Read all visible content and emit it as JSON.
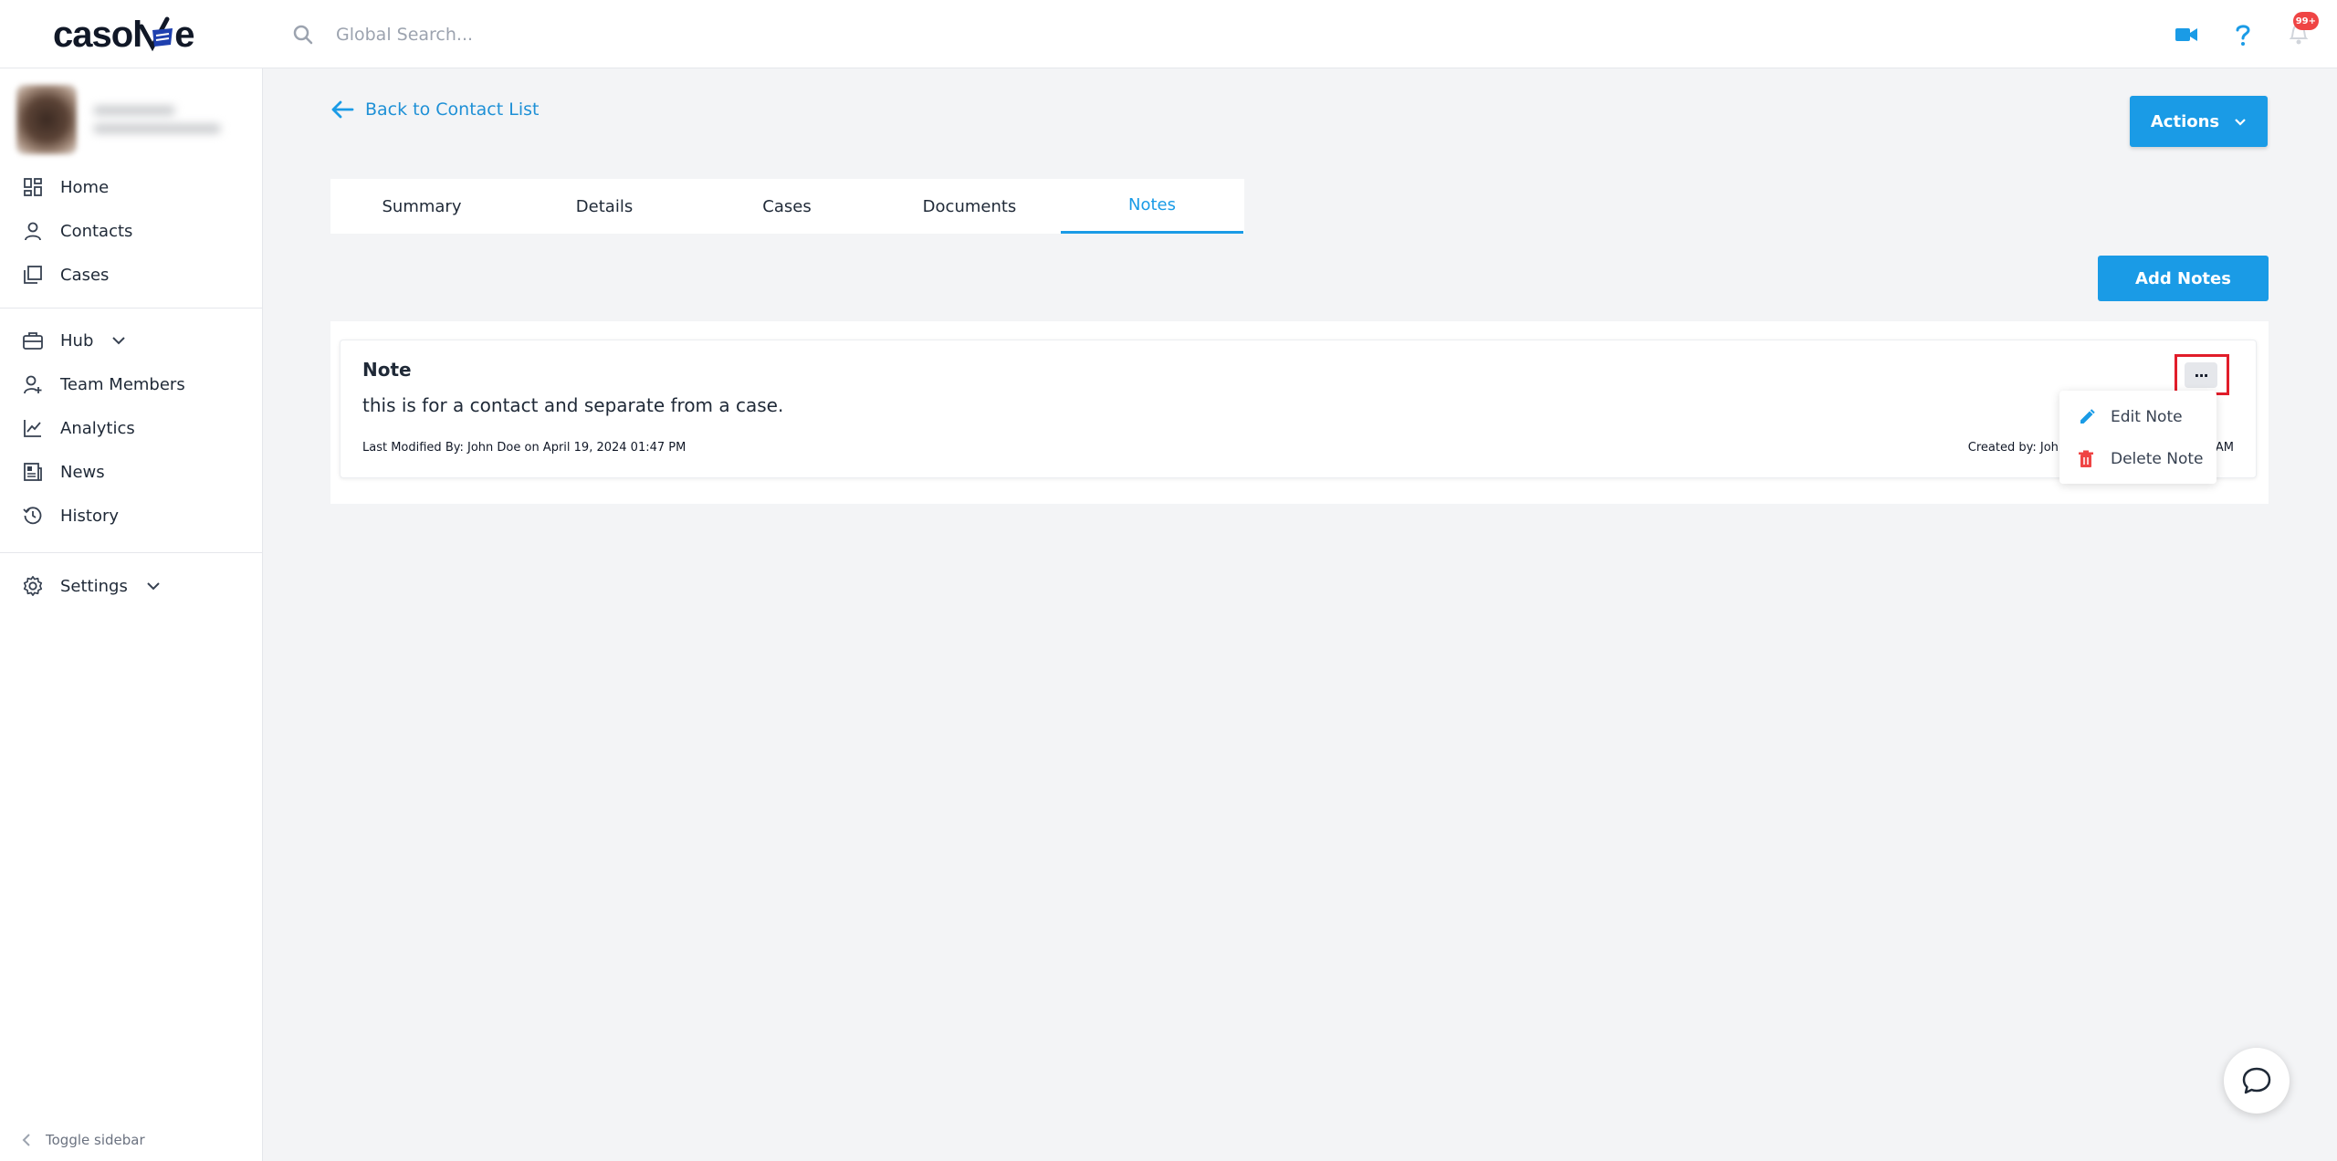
{
  "app": {
    "logo_text_left": "casol",
    "logo_text_right": "e"
  },
  "search": {
    "placeholder": "Global Search..."
  },
  "header": {
    "notification_count": "99+"
  },
  "sidebar": {
    "items": [
      {
        "label": "Home",
        "icon": "dashboard-icon"
      },
      {
        "label": "Contacts",
        "icon": "user-icon"
      },
      {
        "label": "Cases",
        "icon": "cases-icon"
      },
      {
        "label": "Hub",
        "icon": "briefcase-icon"
      },
      {
        "label": "Team Members",
        "icon": "team-icon"
      },
      {
        "label": "Analytics",
        "icon": "analytics-icon"
      },
      {
        "label": "News",
        "icon": "news-icon"
      },
      {
        "label": "History",
        "icon": "history-icon"
      },
      {
        "label": "Settings",
        "icon": "gear-icon"
      }
    ],
    "toggle_label": "Toggle sidebar"
  },
  "main": {
    "back_label": "Back to Contact List",
    "actions_label": "Actions",
    "tabs": [
      {
        "label": "Summary"
      },
      {
        "label": "Details"
      },
      {
        "label": "Cases"
      },
      {
        "label": "Documents"
      },
      {
        "label": "Notes",
        "active": true
      }
    ],
    "add_notes_label": "Add Notes"
  },
  "note": {
    "title": "Note",
    "body": "this is for a contact and separate from a case.",
    "modified": "Last Modified By: John Doe on April 19, 2024 01:47 PM",
    "created": "Created by: Joh",
    "created_tail": "AM",
    "more_label": "···"
  },
  "dropdown": {
    "items": [
      {
        "label": "Edit Note",
        "icon": "pencil-icon"
      },
      {
        "label": "Delete Note",
        "icon": "trash-icon"
      }
    ]
  },
  "colors": {
    "accent": "#1a9be6",
    "danger": "#e11d2a",
    "sidebar_bg": "#ffffff",
    "page_bg": "#f3f4f6"
  }
}
